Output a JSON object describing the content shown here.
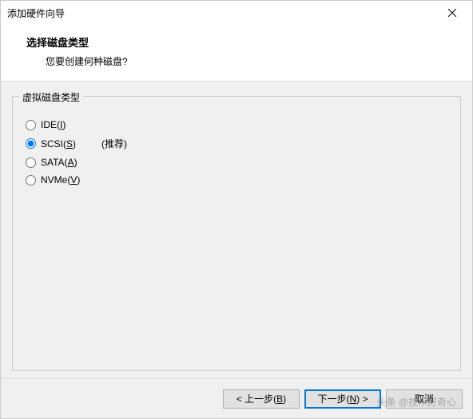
{
  "titlebar": {
    "title": "添加硬件向导"
  },
  "header": {
    "title": "选择磁盘类型",
    "subtitle": "您要创建何种磁盘?"
  },
  "groupbox": {
    "legend": "虚拟磁盘类型",
    "options": [
      {
        "label_prefix": "IDE(",
        "mnemonic": "I",
        "label_suffix": ")",
        "checked": false,
        "recommend": ""
      },
      {
        "label_prefix": "SCSI(",
        "mnemonic": "S",
        "label_suffix": ")",
        "checked": true,
        "recommend": "(推荐)"
      },
      {
        "label_prefix": "SATA(",
        "mnemonic": "A",
        "label_suffix": ")",
        "checked": false,
        "recommend": ""
      },
      {
        "label_prefix": "NVMe(",
        "mnemonic": "V",
        "label_suffix": ")",
        "checked": false,
        "recommend": ""
      }
    ]
  },
  "footer": {
    "back_prefix": "< 上一步(",
    "back_mnemonic": "B",
    "back_suffix": ")",
    "next_prefix": "下一步(",
    "next_mnemonic": "N",
    "next_suffix": ") >",
    "cancel": "取消"
  },
  "watermark": "头条 @技术好奇心"
}
